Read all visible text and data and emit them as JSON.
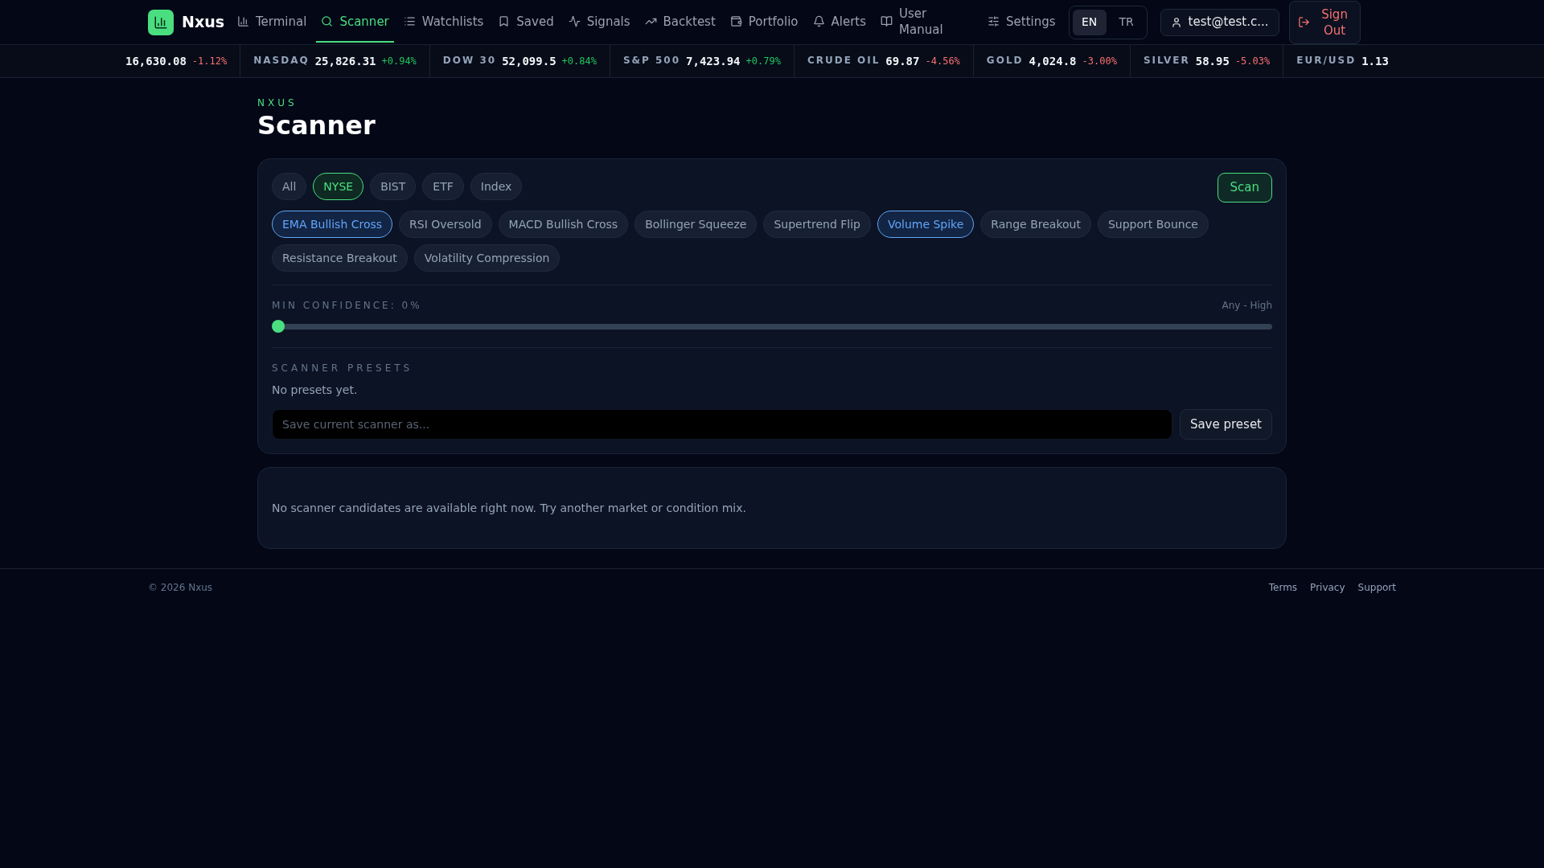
{
  "brand": {
    "name": "Nxus"
  },
  "nav": [
    {
      "label": "Terminal",
      "selected": false
    },
    {
      "label": "Scanner",
      "selected": true
    },
    {
      "label": "Watchlists",
      "selected": false
    },
    {
      "label": "Saved",
      "selected": false
    },
    {
      "label": "Signals",
      "selected": false
    },
    {
      "label": "Backtest",
      "selected": false
    },
    {
      "label": "Portfolio",
      "selected": false
    },
    {
      "label": "Alerts",
      "selected": false
    },
    {
      "label": "User Manual",
      "selected": false
    },
    {
      "label": "Settings",
      "selected": false
    }
  ],
  "languages": [
    {
      "label": "EN",
      "selected": true
    },
    {
      "label": "TR",
      "selected": false
    }
  ],
  "user": {
    "email": "test@test.c..."
  },
  "sign_out": "Sign Out",
  "ticker": [
    {
      "price": "16,630.08",
      "change": "-1.12%",
      "up": false
    },
    {
      "label": "NASDAQ",
      "price": "25,826.31",
      "change": "+0.94%",
      "up": true
    },
    {
      "label": "DOW 30",
      "price": "52,099.5",
      "change": "+0.84%",
      "up": true
    },
    {
      "label": "S&P 500",
      "price": "7,423.94",
      "change": "+0.79%",
      "up": true
    },
    {
      "label": "CRUDE OIL",
      "price": "69.87",
      "change": "-4.56%",
      "up": false
    },
    {
      "label": "GOLD",
      "price": "4,024.8",
      "change": "-3.00%",
      "up": false
    },
    {
      "label": "SILVER",
      "price": "58.95",
      "change": "-5.03%",
      "up": false
    },
    {
      "label": "EUR/USD",
      "price": "1.13"
    }
  ],
  "page": {
    "eyebrow": "NXUS",
    "title": "Scanner"
  },
  "markets": [
    {
      "label": "All",
      "selected": false
    },
    {
      "label": "NYSE",
      "selected": true
    },
    {
      "label": "BIST",
      "selected": false
    },
    {
      "label": "ETF",
      "selected": false
    },
    {
      "label": "Index",
      "selected": false
    }
  ],
  "scan_button": "Scan",
  "conditions": [
    {
      "label": "EMA Bullish Cross",
      "selected": true
    },
    {
      "label": "RSI Oversold",
      "selected": false
    },
    {
      "label": "MACD Bullish Cross",
      "selected": false
    },
    {
      "label": "Bollinger Squeeze",
      "selected": false
    },
    {
      "label": "Supertrend Flip",
      "selected": false
    },
    {
      "label": "Volume Spike",
      "selected": true
    },
    {
      "label": "Range Breakout",
      "selected": false
    },
    {
      "label": "Support Bounce",
      "selected": false
    },
    {
      "label": "Resistance Breakout",
      "selected": false
    },
    {
      "label": "Volatility Compression",
      "selected": false
    }
  ],
  "confidence": {
    "label": "MIN CONFIDENCE: 0%",
    "range": "Any - High",
    "level": 0
  },
  "presets": {
    "heading": "SCANNER PRESETS",
    "empty": "No presets yet.",
    "placeholder": "Save current scanner as...",
    "button": "Save preset"
  },
  "results": {
    "empty": "No scanner candidates are available right now. Try another market or condition mix."
  },
  "footer": {
    "copyright": "© 2026 Nxus",
    "links": [
      "Terms",
      "Privacy",
      "Support"
    ]
  }
}
